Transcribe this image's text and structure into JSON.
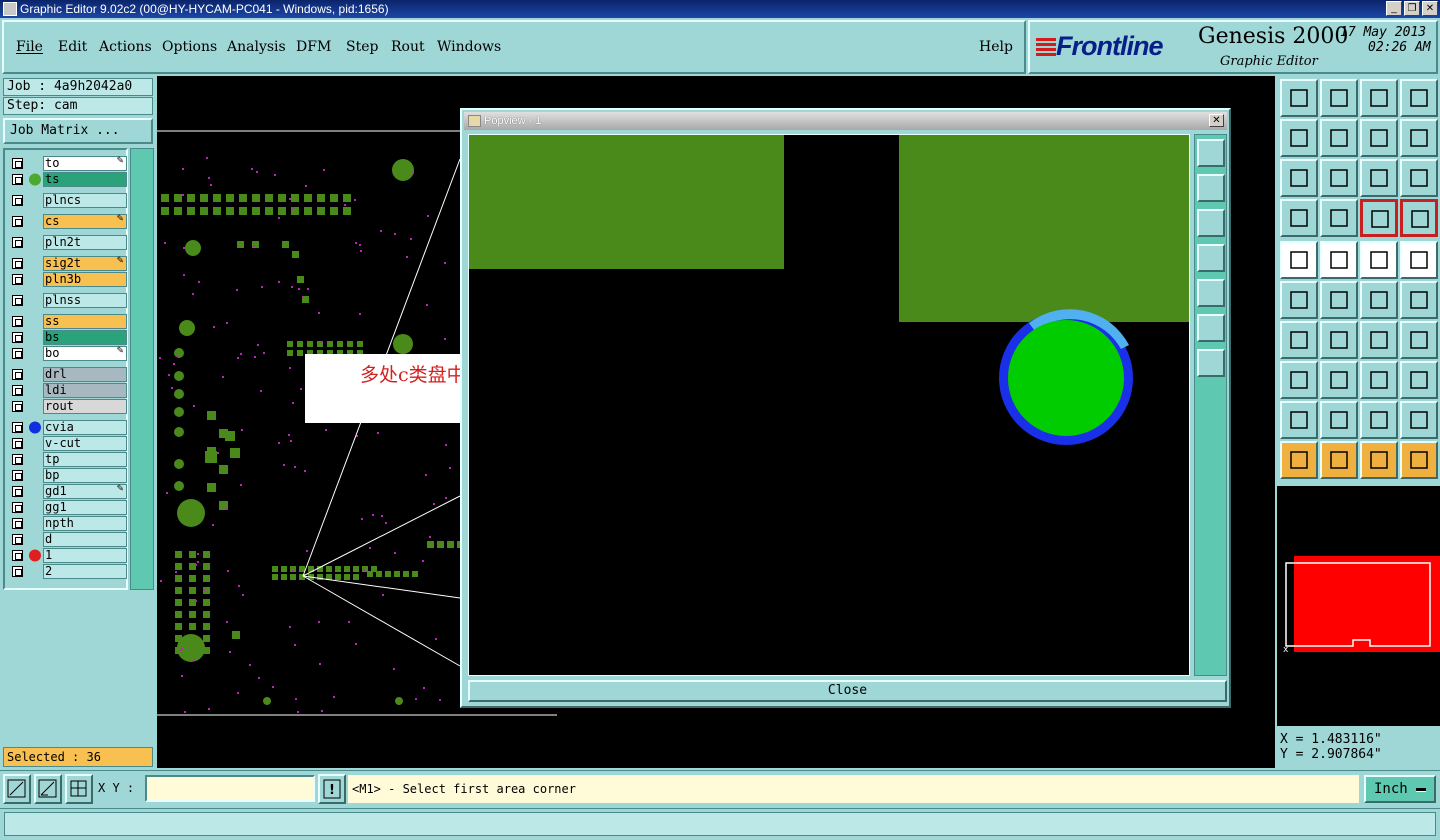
{
  "window": {
    "title": "Graphic Editor 9.02c2 (00@HY-HYCAM-PC041 - Windows, pid:1656)"
  },
  "menu": [
    "File",
    "Edit",
    "Actions",
    "Options",
    "Analysis",
    "DFM",
    "Step",
    "Rout",
    "Windows"
  ],
  "help_label": "Help",
  "brand": {
    "logo": "Frontline",
    "product": "Genesis 2000",
    "subtitle": "Graphic Editor",
    "date": "17 May 2013",
    "time": "02:26 AM"
  },
  "job": {
    "job_label": "Job : 4a9h2042a0",
    "step_label": "Step: cam",
    "matrix_button": "Job Matrix ..."
  },
  "layers": [
    {
      "name": "to",
      "color": "#ffffff",
      "swatch": "",
      "flag": true
    },
    {
      "name": "ts",
      "color": "#2aa37a",
      "swatch": "#4ca830",
      "flag": false
    },
    {
      "name": "plncs",
      "color": "#bde8e8",
      "swatch": "",
      "flag": false
    },
    {
      "name": "cs",
      "color": "#f8c050",
      "swatch": "",
      "flag": true
    },
    {
      "name": "pln2t",
      "color": "#bde8e8",
      "swatch": "",
      "flag": false
    },
    {
      "name": "sig2t",
      "color": "#f8c050",
      "swatch": "",
      "flag": true
    },
    {
      "name": "pln3b",
      "color": "#f8c050",
      "swatch": "",
      "flag": false
    },
    {
      "name": "plnss",
      "color": "#bde8e8",
      "swatch": "",
      "flag": false
    },
    {
      "name": "ss",
      "color": "#f8c050",
      "swatch": "",
      "flag": false
    },
    {
      "name": "bs",
      "color": "#2aa37a",
      "swatch": "",
      "flag": false
    },
    {
      "name": "bo",
      "color": "#ffffff",
      "swatch": "",
      "flag": true
    },
    {
      "name": "drl",
      "color": "#a8b8c0",
      "swatch": "",
      "flag": false
    },
    {
      "name": "ldi",
      "color": "#a8b8c0",
      "swatch": "",
      "flag": false
    },
    {
      "name": "rout",
      "color": "#d8d8d8",
      "swatch": "",
      "flag": false
    },
    {
      "name": "cvia",
      "color": "#bde8e8",
      "swatch": "#1030e0",
      "flag": false
    },
    {
      "name": "v-cut",
      "color": "#bde8e8",
      "swatch": "",
      "flag": false
    },
    {
      "name": "tp",
      "color": "#bde8e8",
      "swatch": "",
      "flag": false
    },
    {
      "name": "bp",
      "color": "#bde8e8",
      "swatch": "",
      "flag": false
    },
    {
      "name": "gd1",
      "color": "#bde8e8",
      "swatch": "",
      "flag": true
    },
    {
      "name": "gg1",
      "color": "#bde8e8",
      "swatch": "",
      "flag": false
    },
    {
      "name": "npth",
      "color": "#bde8e8",
      "swatch": "",
      "flag": false
    },
    {
      "name": "d",
      "color": "#bde8e8",
      "swatch": "",
      "flag": false
    },
    {
      "name": "1",
      "color": "#bde8e8",
      "swatch": "#e02020",
      "flag": false
    },
    {
      "name": "2",
      "color": "#bde8e8",
      "swatch": "",
      "flag": false
    }
  ],
  "selected_label": "Selected : 36",
  "annotation": "多处c类盘中孔漏掏负盘",
  "popview": {
    "title": "Popview - 1",
    "close_label": "Close"
  },
  "coords": {
    "x": "X = 1.483116\"",
    "y": "Y = 2.907864\""
  },
  "bottom": {
    "xy_label": "X Y :",
    "xy_value": "",
    "status": "<M1> - Select first area corner",
    "unit": "Inch"
  },
  "colors": {
    "panel": "#9fd6d6",
    "pcb_green": "#4a8a1a",
    "pad_bright": "#00cc00",
    "ring_blue": "#1030e0",
    "minimap_red": "#ff0000"
  }
}
